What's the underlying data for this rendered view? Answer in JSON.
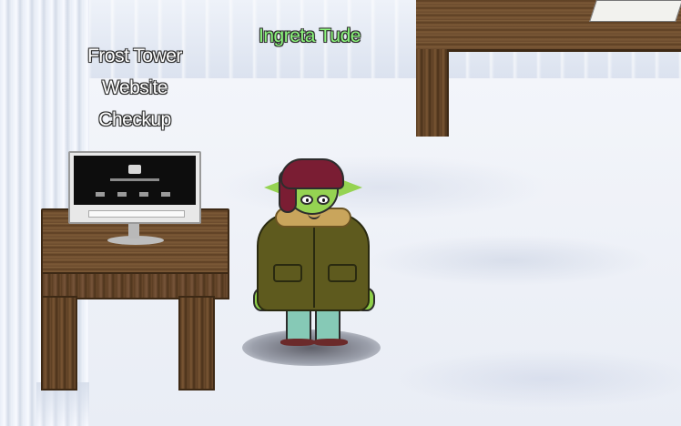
{
  "scene": {
    "station_label": [
      "Frost Tower",
      "Website",
      "Checkup"
    ],
    "player_name": "Ingreta Tude"
  },
  "colors": {
    "player_name": "#8cf57c",
    "label_text": "#ffffff",
    "wood": "#6a4a2c",
    "snow": "#eef2f9"
  }
}
